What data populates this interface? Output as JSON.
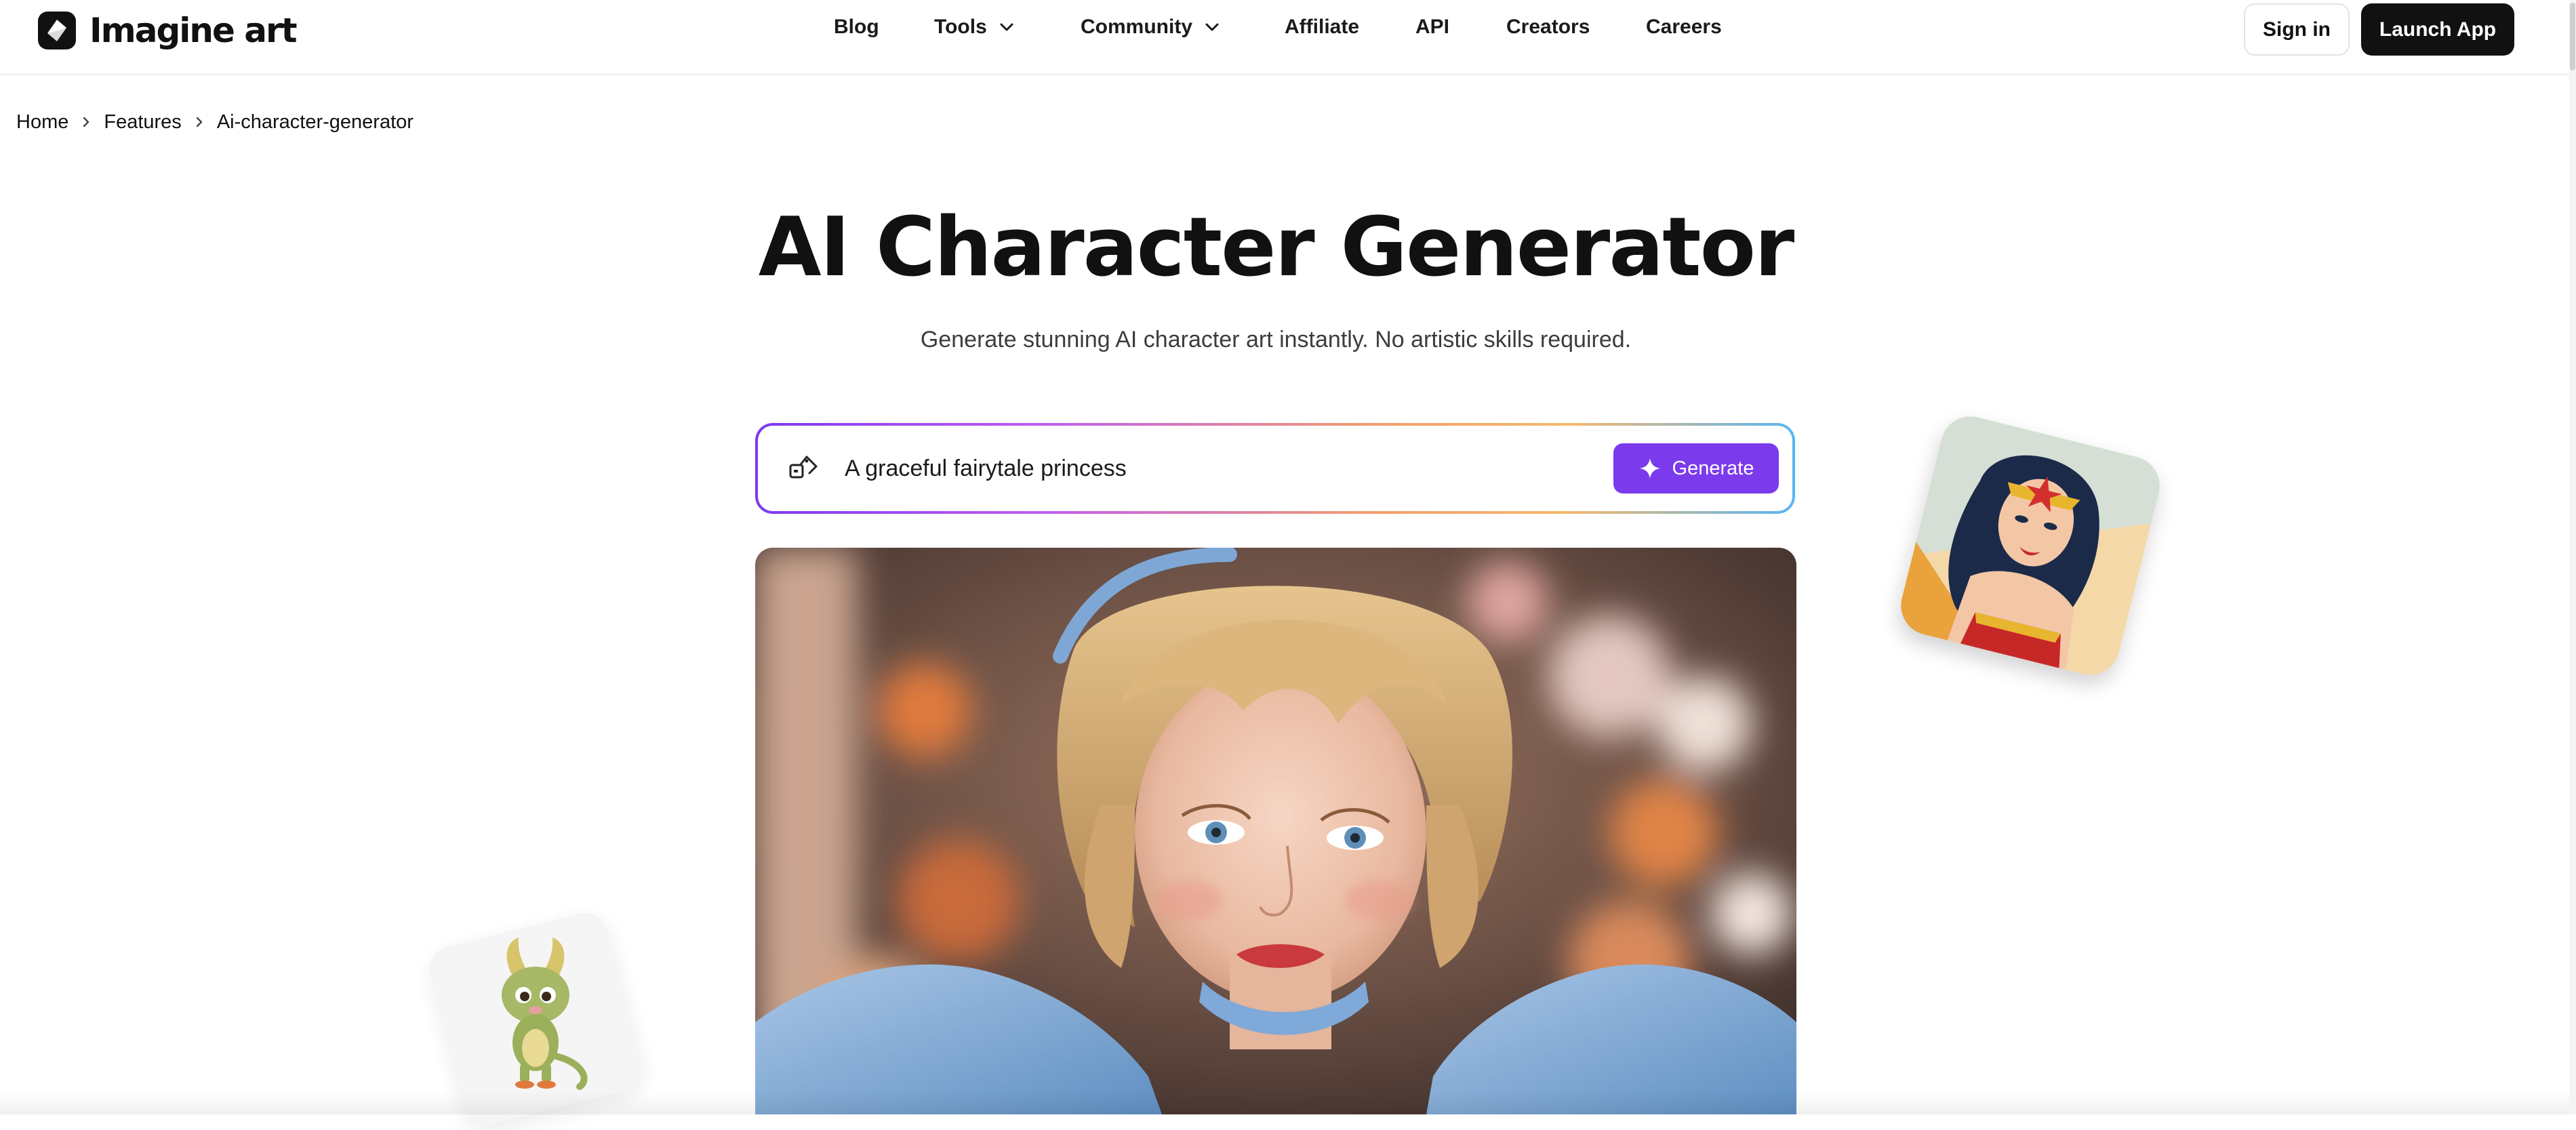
{
  "header": {
    "logo_text": "Imagine art",
    "nav": [
      {
        "label": "Blog",
        "has_dropdown": false
      },
      {
        "label": "Tools",
        "has_dropdown": true
      },
      {
        "label": "Community",
        "has_dropdown": true
      },
      {
        "label": "Affiliate",
        "has_dropdown": false
      },
      {
        "label": "API",
        "has_dropdown": false
      },
      {
        "label": "Creators",
        "has_dropdown": false
      },
      {
        "label": "Careers",
        "has_dropdown": false
      }
    ],
    "signin_label": "Sign in",
    "launch_label": "Launch App"
  },
  "breadcrumb": [
    {
      "label": "Home"
    },
    {
      "label": "Features"
    },
    {
      "label": "Ai-character-generator"
    }
  ],
  "hero": {
    "title": "AI Character Generator",
    "subtitle": "Generate stunning AI character art instantly. No artistic skills required."
  },
  "prompt": {
    "value": "A graceful fairytale princess",
    "generate_label": "Generate",
    "left_icon": "image-upload-icon",
    "button_icon": "sparkle-icon"
  },
  "images": {
    "main": "fairytale-princess-portrait",
    "sticker_right": "comic-heroine-sticker",
    "sticker_left": "baby-dragon-sticker"
  },
  "colors": {
    "accent": "#7c3aed",
    "dark_button": "#111111",
    "text": "#111111",
    "subtext": "#3c3c3c",
    "border_gradient": [
      "#7c3aed",
      "#c15cf0",
      "#f59e6b",
      "#f7b86b",
      "#56b6f5"
    ]
  }
}
